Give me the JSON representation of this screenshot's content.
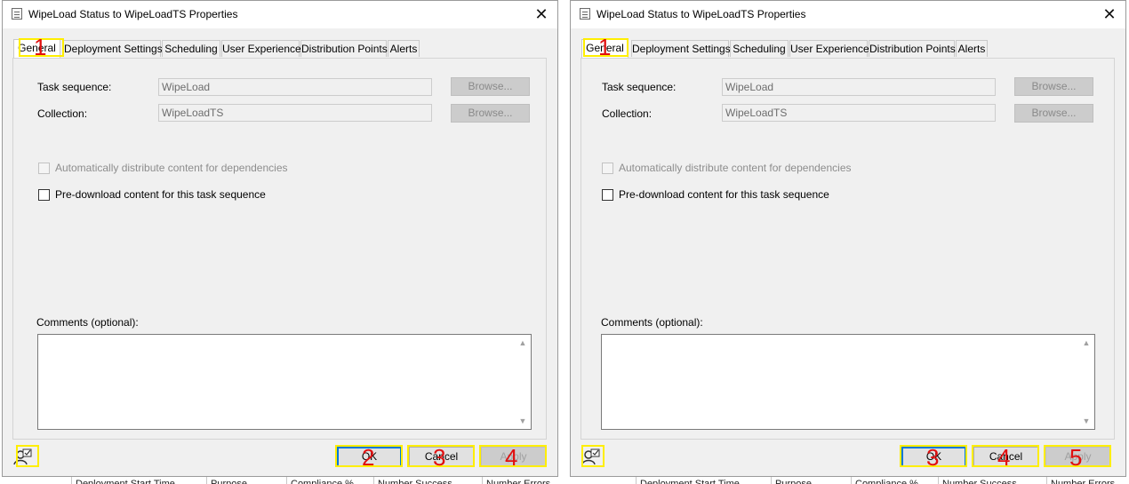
{
  "background": {
    "columns": [
      "Deployment Start Time",
      "Purpose",
      "Compliance %",
      "Number Success",
      "Number Errors"
    ]
  },
  "colors": {
    "highlight": "#ffee00",
    "marker": "#e01010",
    "default_button_border": "#0078d7"
  },
  "dialogs": [
    {
      "title": "WipeLoad Status to WipeLoadTS Properties",
      "tabs": [
        "General",
        "Deployment Settings",
        "Scheduling",
        "User Experience",
        "Distribution Points",
        "Alerts"
      ],
      "active_tab": "General",
      "form": {
        "task_sequence_label": "Task sequence:",
        "task_sequence_value": "WipeLoad",
        "collection_label": "Collection:",
        "collection_value": "WipeLoadTS",
        "browse_label": "Browse...",
        "auto_distribute_label": "Automatically distribute content for dependencies",
        "auto_distribute_checked": false,
        "auto_distribute_enabled": false,
        "predownload_label": "Pre-download content for this task sequence",
        "predownload_checked": false,
        "comments_label": "Comments (optional):",
        "comments_value": ""
      },
      "buttons": {
        "ok": "OK",
        "cancel": "Cancel",
        "apply": "Apply"
      },
      "icons": {
        "title": "properties-icon",
        "bottom": "user-icon"
      },
      "annotations": {
        "tab_general": "1",
        "ok": "2",
        "cancel": "3",
        "apply": "4"
      }
    },
    {
      "title": "WipeLoad Status to WipeLoadTS Properties",
      "tabs": [
        "General",
        "Deployment Settings",
        "Scheduling",
        "User Experience",
        "Distribution Points",
        "Alerts"
      ],
      "active_tab": "General",
      "form": {
        "task_sequence_label": "Task sequence:",
        "task_sequence_value": "WipeLoad",
        "collection_label": "Collection:",
        "collection_value": "WipeLoadTS",
        "browse_label": "Browse...",
        "auto_distribute_label": "Automatically distribute content for dependencies",
        "auto_distribute_checked": false,
        "auto_distribute_enabled": false,
        "predownload_label": "Pre-download content for this task sequence",
        "predownload_checked": false,
        "comments_label": "Comments (optional):",
        "comments_value": ""
      },
      "buttons": {
        "ok": "OK",
        "cancel": "Cancel",
        "apply": "Apply"
      },
      "icons": {
        "title": "properties-icon",
        "bottom": "user-icon"
      },
      "annotations": {
        "tab_general": "1",
        "ok": "3",
        "cancel": "4",
        "apply": "5"
      }
    }
  ]
}
